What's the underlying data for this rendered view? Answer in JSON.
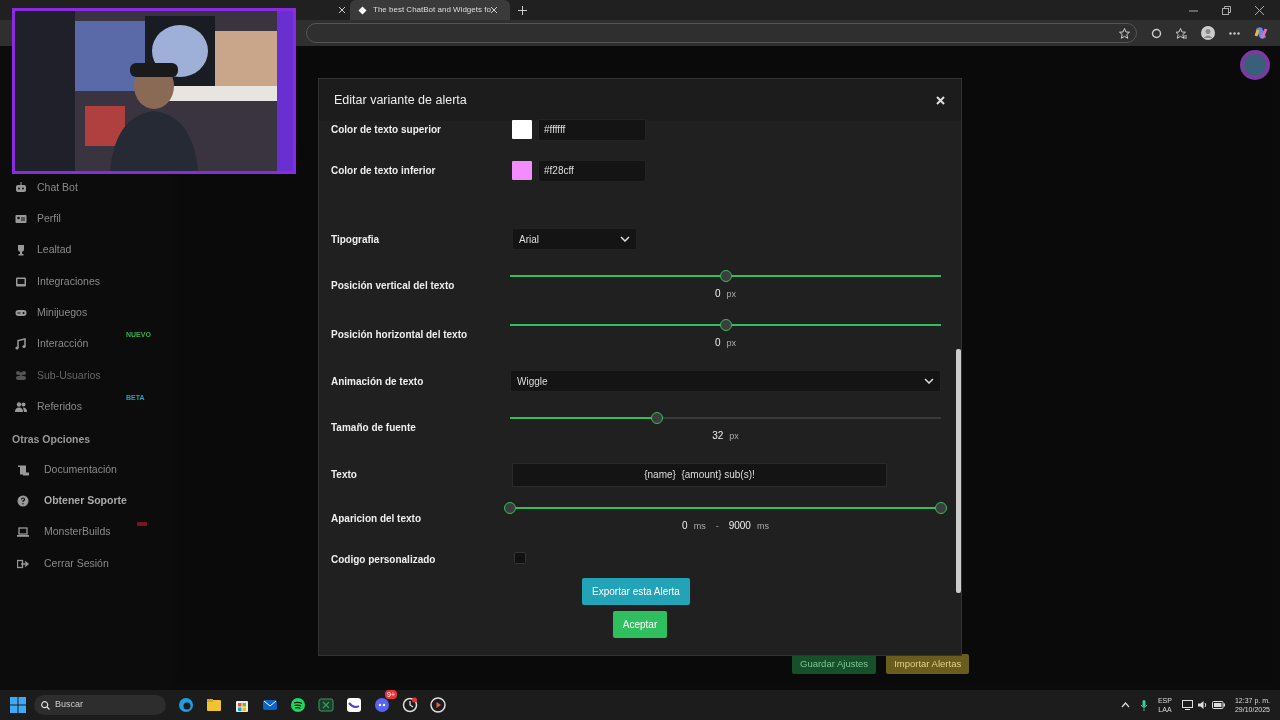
{
  "browser": {
    "tabs": [
      {
        "title": "The best ChatBot and Widgets fo",
        "selected": true
      }
    ]
  },
  "sidebar": {
    "items": [
      {
        "label": "Chat Bot",
        "disabled": false
      },
      {
        "label": "Perfil",
        "disabled": false
      },
      {
        "label": "Lealtad",
        "disabled": false
      },
      {
        "label": "Integraciones",
        "disabled": false
      },
      {
        "label": "Minijuegos",
        "disabled": false
      },
      {
        "label": "Interacción",
        "disabled": false,
        "badge": "NUEVO",
        "color": "#2fb34f"
      },
      {
        "label": "Sub-Usuarios",
        "disabled": true
      },
      {
        "label": "Referidos",
        "disabled": false,
        "badge": "BETA",
        "color": "#22a3b8"
      }
    ],
    "section_title": "Otras Opciones",
    "other_items": [
      {
        "label": "Documentación",
        "bold": false
      },
      {
        "label": "Obtener Soporte",
        "bold": true
      },
      {
        "label": "MonsterBuilds",
        "bold": false
      },
      {
        "label": "Cerrar Sesión",
        "bold": false
      }
    ]
  },
  "background_buttons": [
    {
      "label": "Guardar Ajustes",
      "kind": "success"
    },
    {
      "label": "Importar Alertas",
      "kind": "warning"
    }
  ],
  "modal": {
    "title": "Editar variante de alerta",
    "fields": [
      {
        "kind": "color",
        "label": "Color de texto superior",
        "value": "#ffffff",
        "color": "#ffffff"
      },
      {
        "kind": "color",
        "label": "Color de texto inferior",
        "value": "#f28cff",
        "color": "#f28cff"
      },
      {
        "kind": "select",
        "label": "Tipografia",
        "value": "Arial",
        "wide": false
      },
      {
        "kind": "slider",
        "label": "Posición vertical del texto",
        "level": 0.5,
        "centered": true,
        "reading": "0",
        "unit": "px"
      },
      {
        "kind": "slider",
        "label": "Posición horizontal del texto",
        "level": 0.5,
        "centered": true,
        "reading": "0",
        "unit": "px"
      },
      {
        "kind": "select",
        "label": "Animación de texto",
        "value": "Wiggle",
        "wide": true
      },
      {
        "kind": "slider",
        "label": "Tamaño de fuente",
        "level": 0.34,
        "centered": false,
        "reading": "32",
        "unit": "px"
      },
      {
        "kind": "text",
        "label": "Texto",
        "value": "{name}  {amount} sub(s)!"
      },
      {
        "kind": "range",
        "label": "Aparicion del texto",
        "level": 1,
        "reading_low": "0",
        "unit_low": "ms",
        "separator": "-",
        "reading_high": "9000",
        "unit_high": "ms"
      },
      {
        "kind": "checkbox",
        "label": "Codigo personalizado",
        "checked": false
      }
    ],
    "export_button": "Exportar esta Alerta",
    "accept_button": "Aceptar"
  },
  "taskbar": {
    "search_placeholder": "Buscar",
    "chat_badge": "9+",
    "language": "ESP",
    "layout": "LAA",
    "time": "12:37 p. m.",
    "date": "29/10/2025"
  }
}
